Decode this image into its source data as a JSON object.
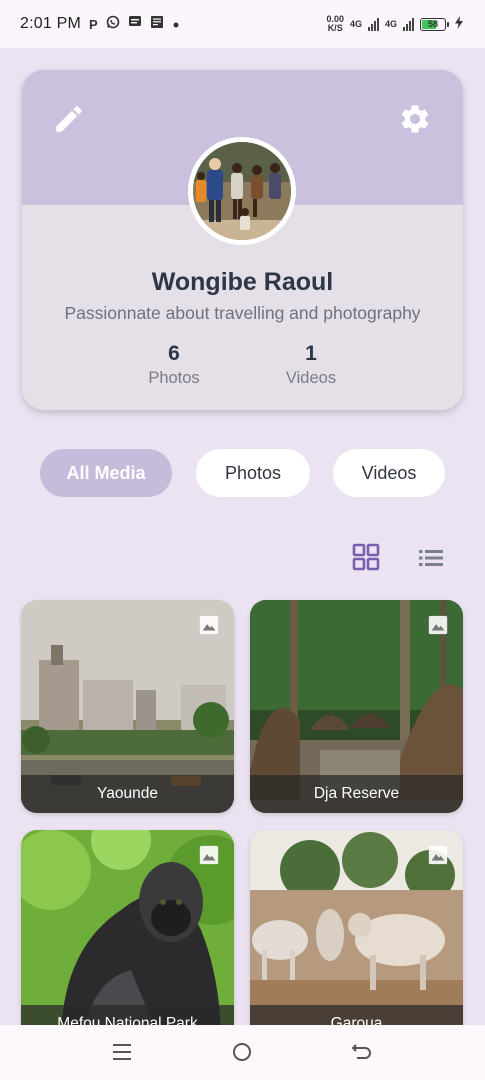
{
  "status_bar": {
    "time": "2:01 PM",
    "notification_icons": [
      "P",
      "whatsapp-icon",
      "sms-icon",
      "email-icon",
      "pdf-icon"
    ],
    "net_speed_value": "0.00",
    "net_speed_unit": "K/S",
    "network_1": "4G",
    "network_2": "4G",
    "battery": "58"
  },
  "profile": {
    "name": "Wongibe Raoul",
    "bio": "Passionnate about travelling and photography",
    "stats": {
      "photos_count": "6",
      "photos_label": "Photos",
      "videos_count": "1",
      "videos_label": "Videos"
    }
  },
  "filters": {
    "all": "All Media",
    "photos": "Photos",
    "videos": "Videos",
    "selected": "All Media"
  },
  "view_mode": "grid",
  "media": [
    {
      "caption": "Yaounde",
      "type": "photo"
    },
    {
      "caption": "Dja Reserve",
      "type": "photo"
    },
    {
      "caption": "Mefou National Park",
      "type": "photo"
    },
    {
      "caption": "Garoua",
      "type": "photo"
    }
  ],
  "colors": {
    "background": "#ebe3f2",
    "banner": "#cbc1df",
    "accent": "#7a5fb0",
    "chip_selected": "#c6bbdb"
  }
}
